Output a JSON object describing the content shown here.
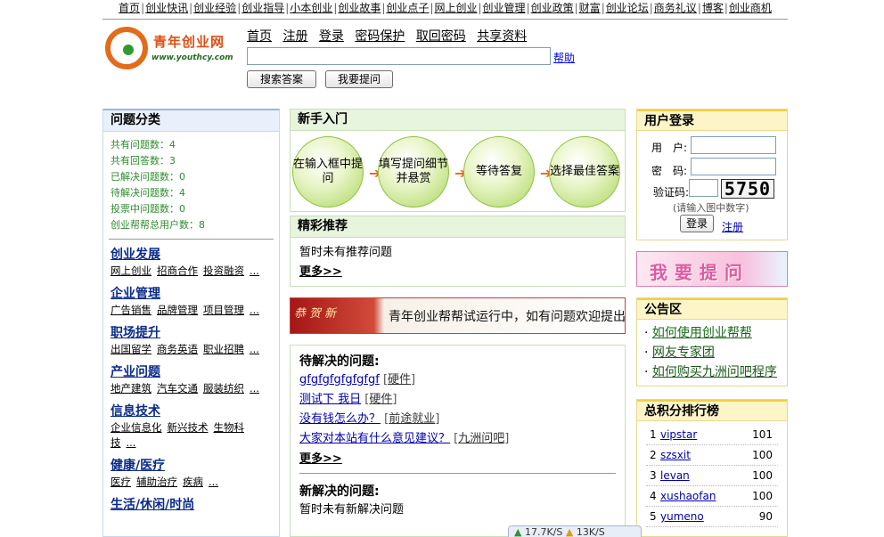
{
  "top_nav": [
    "首页",
    "创业快讯",
    "创业经验",
    "创业指导",
    "小本创业",
    "创业故事",
    "创业点子",
    "网上创业",
    "创业管理",
    "创业政策",
    "财富",
    "创业论坛",
    "商务礼议",
    "博客",
    "创业商机"
  ],
  "logo": {
    "title": "青年创业网",
    "url": "www.youthcy.com"
  },
  "header": {
    "links": [
      "首页",
      "注册",
      "登录",
      "密码保护",
      "取回密码",
      "共享资料"
    ],
    "help": "帮助",
    "search_button": "搜索答案",
    "ask_button": "我要提问"
  },
  "left": {
    "title": "问题分类",
    "stats": [
      "共有问题数：4",
      "共有回答数：3",
      "已解决问题数：0",
      "待解决问题数：4",
      "投票中问题数：0",
      "创业帮帮总用户数：8"
    ],
    "categories": [
      {
        "title": "创业发展",
        "links": [
          "网上创业",
          "招商合作",
          "投资融资",
          "..."
        ]
      },
      {
        "title": "企业管理",
        "links": [
          "广告销售",
          "品牌管理",
          "项目管理",
          "..."
        ]
      },
      {
        "title": "职场提升",
        "links": [
          "出国留学",
          "商务英语",
          "职业招聘",
          "..."
        ]
      },
      {
        "title": "产业问题",
        "links": [
          "地产建筑",
          "汽车交通",
          "服装纺织",
          "..."
        ]
      },
      {
        "title": "信息技术",
        "links": [
          "企业信息化",
          "新兴技术",
          "生物科技",
          "..."
        ]
      },
      {
        "title": "健康/医疗",
        "links": [
          "医疗",
          "辅助治疗",
          "疾病",
          "..."
        ]
      },
      {
        "title": "生活/休闲/时尚",
        "links": []
      }
    ]
  },
  "guide": {
    "title": "新手入门",
    "steps": [
      "在输入框中提问",
      "填写提问细节并悬赏",
      "等待答复",
      "选择最佳答案"
    ],
    "arrow": "➔"
  },
  "recommend": {
    "title": "精彩推荐",
    "empty": "暂时未有推荐问题",
    "more": "更多>>"
  },
  "banner": {
    "deco": "恭贺新",
    "text": "青年创业帮帮试运行中，如有问题欢迎提出"
  },
  "pending": {
    "title": "待解决的问题:",
    "questions": [
      {
        "text": "gfgfgfgfgfgfgf",
        "tag": "硬件"
      },
      {
        "text": "测试下 我日",
        "tag": "硬件"
      },
      {
        "text": "没有钱怎么办？",
        "tag": "前途就业"
      },
      {
        "text": "大家对本站有什么意见建议？",
        "tag": "九洲问吧"
      }
    ],
    "more": "更多>>",
    "solved_title": "新解决的问题:",
    "solved_empty": "暂时未有新解决问题"
  },
  "login": {
    "title": "用户登录",
    "user_label": "用　户:",
    "pass_label": "密　码:",
    "captcha_label": "验证码:",
    "captcha_code": "5750",
    "hint": "(请输入图中数字)",
    "login_button": "登录",
    "register": "注册"
  },
  "ask_banner": "我要提问",
  "notice": {
    "title": "公告区",
    "items": [
      "如何使用创业帮帮",
      "网友专家团",
      "如何购买九洲问吧程序"
    ]
  },
  "rank": {
    "title": "总积分排行榜",
    "rows": [
      {
        "rank": "1",
        "name": "vipstar",
        "score": "101"
      },
      {
        "rank": "2",
        "name": "szsxit",
        "score": "100"
      },
      {
        "rank": "3",
        "name": "levan",
        "score": "100"
      },
      {
        "rank": "4",
        "name": "xushaofan",
        "score": "100"
      },
      {
        "rank": "5",
        "name": "yumeno",
        "score": "90"
      }
    ]
  },
  "statusbar": {
    "up": "17.7K/S",
    "down": "13K/S"
  }
}
